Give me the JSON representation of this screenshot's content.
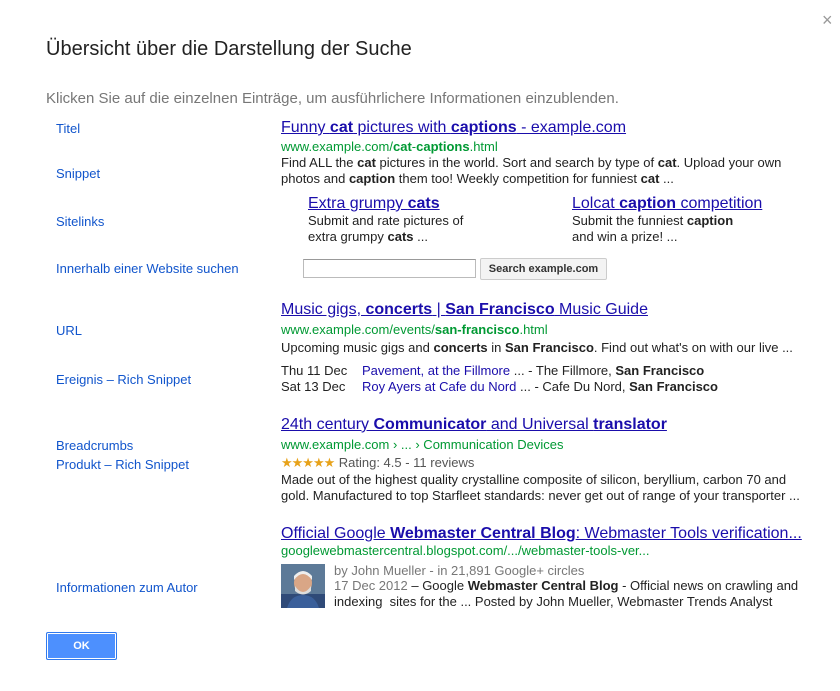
{
  "dialog": {
    "title": "Übersicht über die Darstellung der Suche",
    "subtitle": "Klicken Sie auf die einzelnen Einträge, um ausführlichere Informationen einzublenden.",
    "close_glyph": "×",
    "ok_label": "OK"
  },
  "labels": {
    "title": "Titel",
    "snippet": "Snippet",
    "sitelinks": "Sitelinks",
    "site_search": "Innerhalb einer Website suchen",
    "url": "URL",
    "event": "Ereignis – Rich Snippet",
    "breadcrumbs": "Breadcrumbs",
    "product": "Produkt – Rich Snippet",
    "author": "Informationen zum Autor"
  },
  "result1": {
    "title": [
      "Funny ",
      "cat",
      " pictures with ",
      "captions",
      " - example.com"
    ],
    "url": [
      "www.example.com/",
      "cat",
      "-",
      "captions",
      ".html"
    ],
    "snippet_line1": [
      "Find ALL the ",
      "cat",
      " pictures in the world. Sort and search by type of ",
      "cat",
      ". Upload your own"
    ],
    "snippet_line2": [
      "photos and ",
      "caption",
      " them too! Weekly competition for funniest ",
      "cat",
      " ..."
    ],
    "sitelinks": [
      {
        "title": [
          "Extra grumpy ",
          "cats"
        ],
        "line1": "Submit and rate pictures of",
        "line2": [
          "extra grumpy ",
          "cats",
          " ..."
        ]
      },
      {
        "title": [
          "Lolcat ",
          "caption",
          " competition"
        ],
        "line1": [
          "Submit the funniest ",
          "caption"
        ],
        "line2": "and win a prize! ..."
      }
    ],
    "search_placeholder": "",
    "search_button": "Search example.com"
  },
  "result2": {
    "title": [
      "Music gigs, ",
      "concerts",
      " | ",
      "San Francisco",
      " Music Guide"
    ],
    "url": [
      "www.example.com/events/",
      "san-francisco",
      ".html"
    ],
    "snippet": [
      "Upcoming music gigs and ",
      "concerts",
      " in ",
      "San Francisco",
      ". Find out what's on with our live ..."
    ],
    "events": [
      {
        "date": "Thu 11 Dec",
        "link": "Pavement, at the Fillmore",
        "rest1": " ... - The Fillmore, ",
        "bold": "San Francisco"
      },
      {
        "date": "Sat 13 Dec",
        "link": "Roy Ayers at Cafe du Nord",
        "rest1": " ... - Cafe Du Nord, ",
        "bold": "San Francisco"
      }
    ]
  },
  "result3": {
    "title": [
      "24th century ",
      "Communicator",
      " and Universal ",
      "translator"
    ],
    "breadcrumb": "www.example.com › ... › Communication Devices",
    "stars": "★★★★★",
    "rating_text": "Rating: 4.5 - 11 reviews",
    "rating_value": 4.5,
    "snippet_line1": "Made out of the highest quality crystalline composite of silicon, beryllium, carbon 70 and",
    "snippet_line2": "gold. Manufactured to top Starfleet standards: never get out of range of your transporter ..."
  },
  "result4": {
    "title": [
      "Official Google ",
      "Webmaster Central Blog",
      ": Webmaster Tools verification..."
    ],
    "url": "googlewebmastercentral.blogspot.com/.../webmaster-tools-ver...",
    "author_line": "by John Mueller - in 21,891 Google+ circles",
    "line2": [
      "17 Dec 2012",
      " – Google ",
      "Webmaster Central Blog",
      " - Official news on crawling and"
    ],
    "line3": "indexing  sites for the ... Posted by John Mueller, Webmaster Trends Analyst"
  },
  "colors": {
    "link": "#1a0dab",
    "label": "#1155cc",
    "url_green": "#009933",
    "star": "#e7a21a",
    "ok_button": "#4d90fe"
  }
}
